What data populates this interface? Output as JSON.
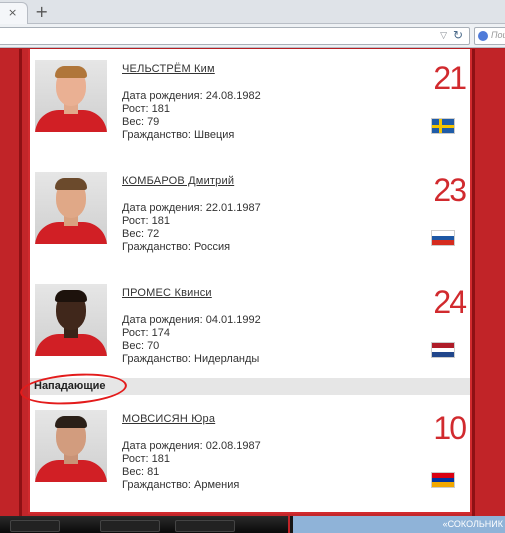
{
  "browser": {
    "tab_close_symbol": "×",
    "new_tab_symbol": "+",
    "search_placeholder": "Пои"
  },
  "section": {
    "label": "Нападающие",
    "highlight_color": "#e31b1b"
  },
  "players": [
    {
      "name": "ЧЕЛЬСТРЁМ Ким",
      "birth": "Дата рождения: 24.08.1982",
      "height": "Рост: 181",
      "weight": "Вес: 79",
      "citizenship": "Гражданство: Швеция",
      "number": "21",
      "flag": "sweden-flag"
    },
    {
      "name": "КОМБАРОВ Дмитрий",
      "birth": "Дата рождения: 22.01.1987",
      "height": "Рост: 181",
      "weight": "Вес: 72",
      "citizenship": "Гражданство: Россия",
      "number": "23",
      "flag": "russia-flag"
    },
    {
      "name": "ПРОМЕС Квинси",
      "birth": "Дата рождения: 04.01.1992",
      "height": "Рост: 174",
      "weight": "Вес: 70",
      "citizenship": "Гражданство: Нидерланды",
      "number": "24",
      "flag": "netherlands-flag"
    },
    {
      "name": "МОВСИСЯН Юра",
      "birth": "Дата рождения: 02.08.1987",
      "height": "Рост: 181",
      "weight": "Вес: 81",
      "citizenship": "Гражданство: Армения",
      "number": "10",
      "flag": "armenia-flag"
    }
  ],
  "footer": {
    "right_text": "«СОКОЛЬНИК"
  },
  "colors": {
    "accent": "#d12a2e",
    "club_red": "#c12428"
  }
}
